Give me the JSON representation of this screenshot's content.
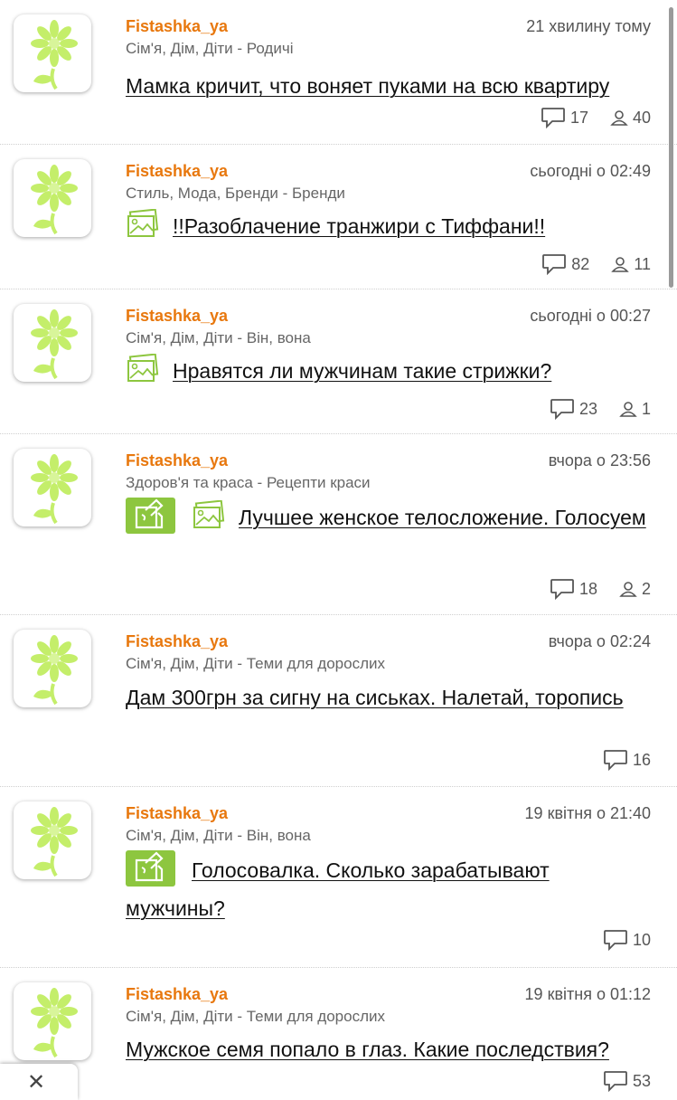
{
  "colors": {
    "author": "#e8780e",
    "accent_green": "#8dc63f",
    "flower_green": "#c4ee6a"
  },
  "posts": [
    {
      "author": "Fistashka_ya",
      "time": "21 хвилину тому",
      "category": "Сім'я, Дім, Діти - Родичі",
      "title": "Мамка кричит, что воняет пуками на всю квартиру",
      "comments": "17",
      "participants": "40"
    },
    {
      "author": "Fistashka_ya",
      "time": "сьогодні о 02:49",
      "category": "Стиль, Мода, Бренди - Бренди",
      "title": "!!Разоблачение транжири с Тиффани!!",
      "comments": "82",
      "participants": "11"
    },
    {
      "author": "Fistashka_ya",
      "time": "сьогодні о 00:27",
      "category": "Сім'я, Дім, Діти - Він, вона",
      "title": "Нравятся ли мужчинам такие стрижки?",
      "comments": "23",
      "participants": "1"
    },
    {
      "author": "Fistashka_ya",
      "time": "вчора о 23:56",
      "category": "Здоров'я та краса - Рецепти краси",
      "title": "Лучшее женское телосложение. Голосуем",
      "comments": "18",
      "participants": "2"
    },
    {
      "author": "Fistashka_ya",
      "time": "вчора о 02:24",
      "category": "Сім'я, Дім, Діти - Теми для дорослих",
      "title": "Дам 300грн за сигну на сиськах. Налетай, торопись",
      "comments": "16"
    },
    {
      "author": "Fistashka_ya",
      "time": "19 квітня о 21:40",
      "category": "Сім'я, Дім, Діти - Він, вона",
      "title": "Голосовалка. Сколько зарабатывают мужчины?",
      "comments": "10"
    },
    {
      "author": "Fistashka_ya",
      "time": "19 квітня о 01:12",
      "category": "Сім'я, Дім, Діти - Теми для дорослих",
      "title": "Мужское семя попало в глаз. Какие последствия?",
      "comments": "53"
    }
  ],
  "close_label": "✕"
}
